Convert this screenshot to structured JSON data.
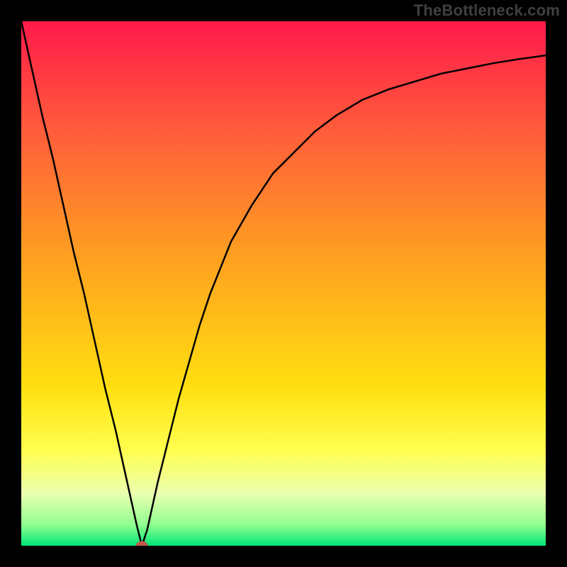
{
  "watermark": "TheBottleneck.com",
  "colors": {
    "frame": "#000000",
    "grad_top": "#ff1a4a",
    "grad_mid": "#ffb000",
    "grad_yellow": "#ffff33",
    "grad_pale": "#f5ffb0",
    "grad_green": "#00e676",
    "curve_stroke": "#000000",
    "marker_fill": "#c2564b",
    "marker_stroke": "#c2564b"
  },
  "chart_data": {
    "type": "line",
    "title": "",
    "xlabel": "",
    "ylabel": "",
    "xlim": [
      0,
      100
    ],
    "ylim": [
      0,
      100
    ],
    "x": [
      0,
      2,
      4,
      6,
      8,
      10,
      12,
      14,
      16,
      18,
      20,
      22,
      23,
      24,
      26,
      28,
      30,
      32,
      34,
      36,
      38,
      40,
      44,
      48,
      52,
      56,
      60,
      65,
      70,
      75,
      80,
      85,
      90,
      95,
      100
    ],
    "values": [
      100,
      91,
      82,
      74,
      65,
      56,
      48,
      39,
      30,
      22,
      13,
      4,
      0,
      3,
      12,
      20,
      28,
      35,
      42,
      48,
      53,
      58,
      65,
      71,
      75,
      79,
      82,
      85,
      87,
      88.5,
      90,
      91,
      92,
      92.8,
      93.5
    ],
    "marker": {
      "x": 23,
      "y": 0
    },
    "gradient_stops": [
      {
        "offset": 0.0,
        "color": "#ff1a4a"
      },
      {
        "offset": 0.2,
        "color": "#ff5a3c"
      },
      {
        "offset": 0.45,
        "color": "#ffa020"
      },
      {
        "offset": 0.7,
        "color": "#ffe010"
      },
      {
        "offset": 0.82,
        "color": "#ffff50"
      },
      {
        "offset": 0.9,
        "color": "#eaffb0"
      },
      {
        "offset": 0.96,
        "color": "#90ff90"
      },
      {
        "offset": 1.0,
        "color": "#00e676"
      }
    ]
  }
}
